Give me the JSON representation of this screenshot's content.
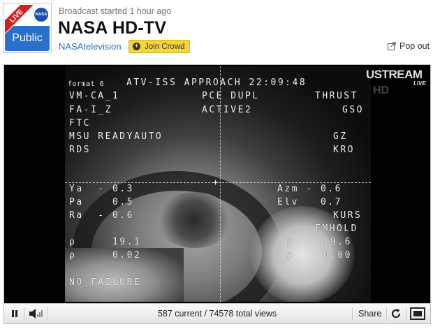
{
  "header": {
    "thumb": {
      "live_label": "LIVE",
      "public_label": "Public",
      "meatball_label": "NASA"
    },
    "status": "Broadcast started 1 hour ago",
    "title": "NASA HD-TV",
    "channel": "NASAtelevision",
    "join_label": "Join Crowd",
    "popout_label": "Pop out"
  },
  "video": {
    "osd_lines": {
      "format": "format 6",
      "l1": "ATV-ISS APPROACH 22:09:48",
      "l2_left": "VM-CA_1",
      "l2_mid": "PCE DUPL",
      "l2_right": "THRUST",
      "l3_left": "FA-I_Z",
      "l3_mid": "ACTIVE2",
      "l3_right": "GSO",
      "l4": "FTC",
      "l5_left": "MSU READYAUTO",
      "l5_right": "GZ",
      "l6_left": "RDS",
      "l6_right": "KRO",
      "l7_left": "Ya  - 0.3",
      "l7_right": "Azm - 0.6",
      "l8_left": "Pa    0.5",
      "l8_right": "Elv   0.7",
      "l9_left": "Ra  - 0.6",
      "l9_right": "KURS",
      "l10_right": "FMHOLD",
      "l11_left": "ρ     19.1",
      "l11_right": "ρ    19.6",
      "l12_left": "ρ     0.02",
      "l12_right": "ρ    0.00",
      "l13": "NO_FAILURE"
    },
    "logo": "USTREAM",
    "logo_live": "LIVE",
    "hd": "HD"
  },
  "controls": {
    "views": "587 current / 74578 total views",
    "share_label": "Share"
  },
  "icons": {
    "pause": "pause-icon",
    "volume": "volume-icon",
    "refresh": "refresh-icon",
    "fullscreen": "fullscreen-icon",
    "popout": "popout-icon",
    "join": "plus-circle-icon"
  },
  "colors": {
    "link": "#2a72c4",
    "join_button": "#f6d43c",
    "live_ribbon": "#d71c1c",
    "public_badge": "#2a6fc9"
  }
}
